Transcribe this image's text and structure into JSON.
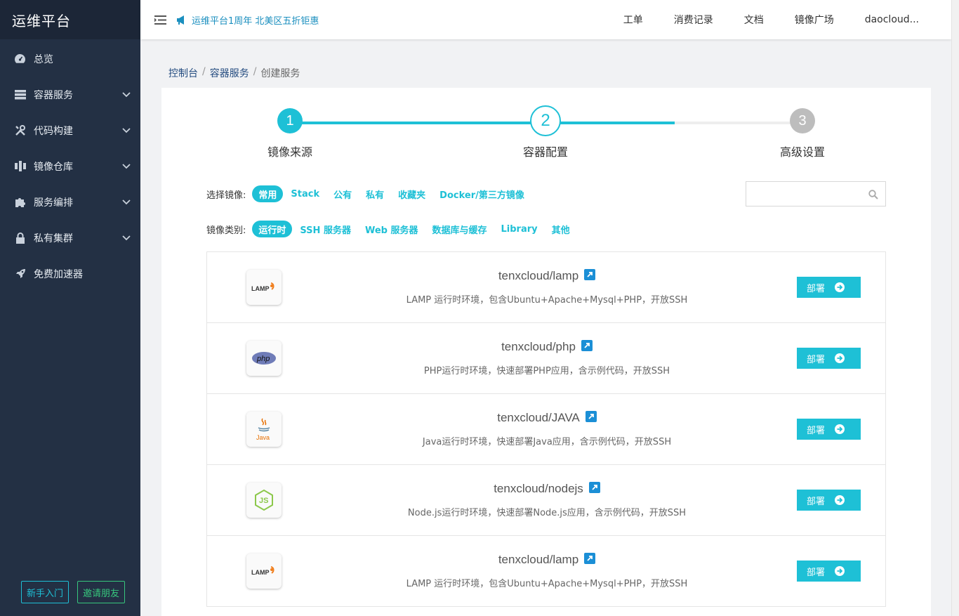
{
  "brand": "运维平台",
  "sidebar": {
    "items": [
      {
        "label": "总览",
        "icon": "dashboard-icon",
        "expandable": false
      },
      {
        "label": "容器服务",
        "icon": "server-icon",
        "expandable": true
      },
      {
        "label": "代码构建",
        "icon": "tools-icon",
        "expandable": true
      },
      {
        "label": "镜像仓库",
        "icon": "cube-icon",
        "expandable": true
      },
      {
        "label": "服务编排",
        "icon": "puzzle-icon",
        "expandable": true
      },
      {
        "label": "私有集群",
        "icon": "lock-icon",
        "expandable": true
      },
      {
        "label": "免费加速器",
        "icon": "rocket-icon",
        "expandable": false
      }
    ],
    "guide_label": "新手入门",
    "invite_label": "邀请朋友"
  },
  "topbar": {
    "notice": "运维平台1周年 北美区五折钜惠",
    "links": [
      "工单",
      "消费记录",
      "文档",
      "镜像广场",
      "daocloud..."
    ]
  },
  "breadcrumb": {
    "items": [
      "控制台",
      "容器服务",
      "创建服务"
    ]
  },
  "steps": [
    {
      "number": "1",
      "label": "镜像来源",
      "state": "done"
    },
    {
      "number": "2",
      "label": "容器配置",
      "state": "current"
    },
    {
      "number": "3",
      "label": "高级设置",
      "state": "todo"
    }
  ],
  "filters": {
    "image_label": "选择镜像:",
    "image_options": [
      "常用",
      "Stack",
      "公有",
      "私有",
      "收藏夹",
      "Docker/第三方镜像"
    ],
    "image_selected": "常用",
    "category_label": "镜像类别:",
    "category_options": [
      "运行时",
      "SSH 服务器",
      "Web 服务器",
      "数据库与缓存",
      "Library",
      "其他"
    ],
    "category_selected": "运行时",
    "search_placeholder": ""
  },
  "images": [
    {
      "name": "tenxcloud/lamp",
      "desc": "LAMP 运行时环境，包含Ubuntu+Apache+Mysql+PHP，开放SSH",
      "logo": "lamp-logo",
      "logo_text": "LAMP"
    },
    {
      "name": "tenxcloud/php",
      "desc": "PHP运行时环境，快速部署PHP应用，含示例代码，开放SSH",
      "logo": "php-logo",
      "logo_text": "php"
    },
    {
      "name": "tenxcloud/JAVA",
      "desc": "Java运行时环境，快速部署Java应用，含示例代码，开放SSH",
      "logo": "java-logo",
      "logo_text": "Java"
    },
    {
      "name": "tenxcloud/nodejs",
      "desc": "Node.js运行时环境，快速部署Node.js应用，含示例代码，开放SSH",
      "logo": "nodejs-logo",
      "logo_text": "JS"
    },
    {
      "name": "tenxcloud/lamp",
      "desc": "LAMP 运行时环境，包含Ubuntu+Apache+Mysql+PHP，开放SSH",
      "logo": "lamp-logo",
      "logo_text": "LAMP"
    }
  ],
  "deploy_label": "部署",
  "colors": {
    "sidebar_bg": "#233044",
    "accent": "#1ec0d6",
    "link": "#1b8fbf"
  }
}
